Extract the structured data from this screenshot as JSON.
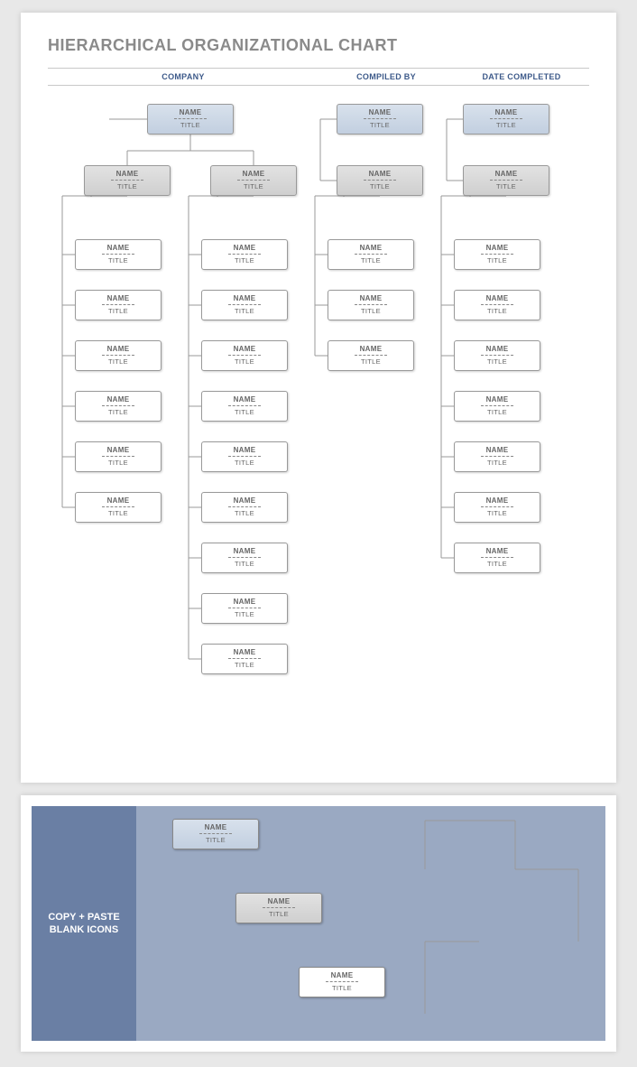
{
  "title": "HIERARCHICAL ORGANIZATIONAL CHART",
  "hdr": {
    "company": "COMPANY",
    "compiled": "COMPILED BY",
    "date": "DATE COMPLETED"
  },
  "labels": {
    "name": "NAME",
    "title": "TITLE"
  },
  "panel": {
    "side": "COPY + PASTE BLANK ICONS"
  },
  "chart_data": {
    "type": "table",
    "columns": [
      {
        "top": 1,
        "mgr": 1,
        "leaf": 6
      },
      {
        "top": 0,
        "mgr": 1,
        "leaf": 9
      },
      {
        "top": 1,
        "mgr": 1,
        "leaf": 3
      },
      {
        "top": 1,
        "mgr": 1,
        "leaf": 7
      }
    ]
  }
}
